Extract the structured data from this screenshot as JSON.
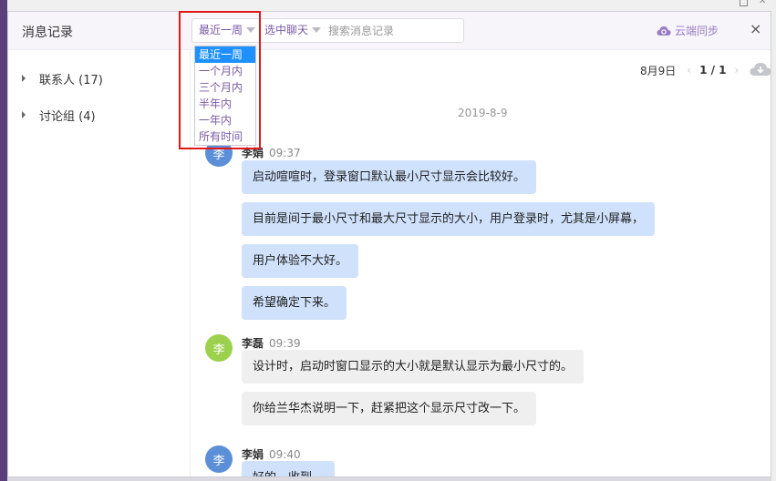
{
  "window": {
    "title": "消息记录"
  },
  "filters": {
    "time_selected": "最近一周",
    "chat_selected": "选中聊天",
    "search_placeholder": "搜索消息记录",
    "time_options": [
      "最近一周",
      "一个月内",
      "三个月内",
      "半年内",
      "一年内",
      "所有时间"
    ]
  },
  "header": {
    "cloud_sync": "云端同步",
    "close": "×"
  },
  "sidebar": {
    "items": [
      {
        "label": "联系人 (17)"
      },
      {
        "label": "讨论组 (4)"
      }
    ]
  },
  "pager": {
    "date": "8月9日",
    "page": "1 / 1",
    "prev": "‹",
    "next": "›"
  },
  "chat": {
    "date_separator": "2019-8-9",
    "groups": [
      {
        "sender": "李娟",
        "avatar": "李",
        "time": "09:37",
        "messages": [
          "启动喧喧时，登录窗口默认最小尺寸显示会比较好。",
          "目前是间于最小尺寸和最大尺寸显示的大小，用户登录时，尤其是小屏幕，",
          "用户体验不大好。",
          "希望确定下来。"
        ]
      },
      {
        "sender": "李磊",
        "avatar": "李",
        "time": "09:39",
        "messages": [
          "设计时，启动时窗口显示的大小就是默认显示为最小尺寸的。",
          "你给兰华杰说明一下，赶紧把这个显示尺寸改一下。"
        ]
      },
      {
        "sender": "李娟",
        "avatar": "李",
        "time": "09:40",
        "messages": [
          "好的，收到。"
        ]
      }
    ]
  },
  "colors": {
    "accent": "#7b5aa6",
    "highlight": "#e01818",
    "avatar_blue": "#5b8fd8",
    "avatar_green": "#9bd14c",
    "bubble_mine": "#cfe1fb",
    "bubble_other": "#efefef"
  }
}
